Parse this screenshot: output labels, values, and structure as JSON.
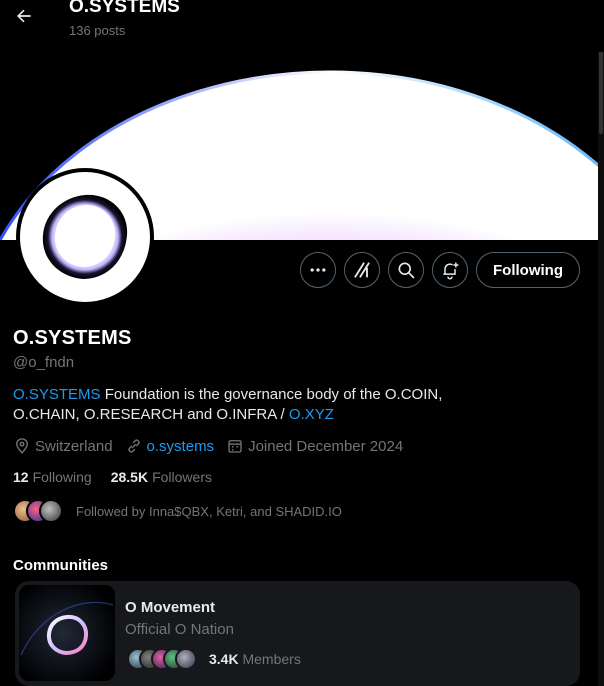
{
  "header": {
    "title": "O.SYSTEMS",
    "post_count": "136 posts"
  },
  "actions": {
    "following_label": "Following"
  },
  "profile": {
    "name": "O.SYSTEMS",
    "handle": "@o_fndn",
    "bio": {
      "link1": "O.SYSTEMS",
      "text1": " Foundation is the governance body of the O.COIN, O.CHAIN, O.RESEARCH and O.INFRA  / ",
      "link2": "O.XYZ"
    },
    "location": "Switzerland",
    "website": "o.systems",
    "joined": "Joined December 2024",
    "following_count": "12",
    "following_label": "Following",
    "followers_count": "28.5K",
    "followers_label": "Followers",
    "followed_by": "Followed by Inna$QBX, Ketri, and SHADID.IO"
  },
  "communities": {
    "section_title": "Communities",
    "items": [
      {
        "name": "O Movement",
        "subtitle": "Official O Nation",
        "members_count": "3.4K",
        "members_label": " Members"
      }
    ]
  },
  "colors": {
    "accent": "#1d9bf0",
    "muted": "#71767b",
    "background": "#000000"
  }
}
